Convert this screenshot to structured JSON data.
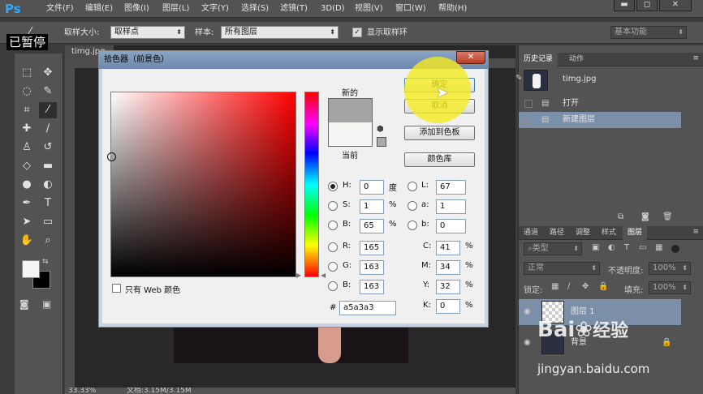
{
  "app": {
    "logo": "Ps",
    "caption_overlay": "已暂停"
  },
  "menu": {
    "items": [
      "文件(F)",
      "编辑(E)",
      "图像(I)",
      "图层(L)",
      "文字(Y)",
      "选择(S)",
      "滤镜(T)",
      "3D(D)",
      "视图(V)",
      "窗口(W)",
      "帮助(H)"
    ]
  },
  "window_controls": {
    "minimize": "▬",
    "maximize": "◻",
    "close": "✕"
  },
  "options_bar": {
    "sample_size_label": "取样大小:",
    "sample_size_value": "取样点",
    "sample_label": "样本:",
    "sample_value": "所有图层",
    "show_ring_label": "显示取样环",
    "workspace_value": "基本功能"
  },
  "document": {
    "tab_title": "timg.jpg",
    "zoom": "33.33%",
    "doc_info": "文档:3.15M/3.15M"
  },
  "tools": [
    {
      "icon": "⬚",
      "name": "marquee-tool-icon"
    },
    {
      "icon": "✥",
      "name": "move-tool-icon"
    },
    {
      "icon": "◌",
      "name": "lasso-tool-icon"
    },
    {
      "icon": "✎",
      "name": "quick-selection-tool-icon"
    },
    {
      "icon": "⌗",
      "name": "crop-tool-icon"
    },
    {
      "icon": "⁄",
      "name": "eyedropper-tool-icon"
    },
    {
      "icon": "✚",
      "name": "healing-brush-icon"
    },
    {
      "icon": "∕",
      "name": "brush-tool-icon"
    },
    {
      "icon": "♙",
      "name": "clone-stamp-icon"
    },
    {
      "icon": "↺",
      "name": "history-brush-icon"
    },
    {
      "icon": "◇",
      "name": "eraser-tool-icon"
    },
    {
      "icon": "▬",
      "name": "gradient-tool-icon"
    },
    {
      "icon": "●",
      "name": "blur-tool-icon"
    },
    {
      "icon": "◐",
      "name": "dodge-tool-icon"
    },
    {
      "icon": "✒",
      "name": "pen-tool-icon"
    },
    {
      "icon": "T",
      "name": "type-tool-icon"
    },
    {
      "icon": "➤",
      "name": "path-selection-icon"
    },
    {
      "icon": "▭",
      "name": "shape-tool-icon"
    },
    {
      "icon": "✋",
      "name": "hand-tool-icon"
    },
    {
      "icon": "⌕",
      "name": "zoom-tool-icon"
    }
  ],
  "colors": {
    "foreground": "#f7f4f4",
    "background": "#000000",
    "new_swatch": "#a5a3a3",
    "current_swatch": "#f7f4f4",
    "accent_selection": "#7c8fa8"
  },
  "picker": {
    "title": "拾色器（前景色）",
    "close_label": "✕",
    "new_label": "新的",
    "current_label": "当前",
    "web_only_label": "只有 Web 颜色",
    "ok_label": "确定",
    "cancel_label": "取消",
    "add_swatch_label": "添加到色板",
    "library_label": "颜色库",
    "hsb": [
      {
        "key": "H:",
        "value": "0",
        "unit": "度",
        "checked": true
      },
      {
        "key": "S:",
        "value": "1",
        "unit": "%",
        "checked": false
      },
      {
        "key": "B:",
        "value": "65",
        "unit": "%",
        "checked": false
      }
    ],
    "rgb": [
      {
        "key": "R:",
        "value": "165"
      },
      {
        "key": "G:",
        "value": "163"
      },
      {
        "key": "B:",
        "value": "163"
      }
    ],
    "lab": [
      {
        "key": "L:",
        "value": "67"
      },
      {
        "key": "a:",
        "value": "1"
      },
      {
        "key": "b:",
        "value": "0"
      }
    ],
    "cmyk": [
      {
        "key": "C:",
        "value": "41",
        "unit": "%"
      },
      {
        "key": "M:",
        "value": "34",
        "unit": "%"
      },
      {
        "key": "Y:",
        "value": "32",
        "unit": "%"
      },
      {
        "key": "K:",
        "value": "0",
        "unit": "%"
      }
    ],
    "hex_label": "#",
    "hex_value": "a5a3a3"
  },
  "history_panel": {
    "tabs": [
      "历史记录",
      "动作"
    ],
    "snapshot": "timg.jpg",
    "items": [
      "打开",
      "新建图层"
    ]
  },
  "layers_panel": {
    "tabs": [
      "通道",
      "路径",
      "调整",
      "样式",
      "图层"
    ],
    "filter_value": "类型",
    "blend_mode": "正常",
    "opacity_label": "不透明度:",
    "opacity_value": "100%",
    "lock_label": "锁定:",
    "fill_label": "填充:",
    "fill_value": "100%",
    "layers": [
      "图层 1",
      "背景"
    ]
  },
  "watermark": {
    "brand": "Bai",
    "brand_suffix": "经验",
    "url": "jingyan.baidu.com"
  }
}
